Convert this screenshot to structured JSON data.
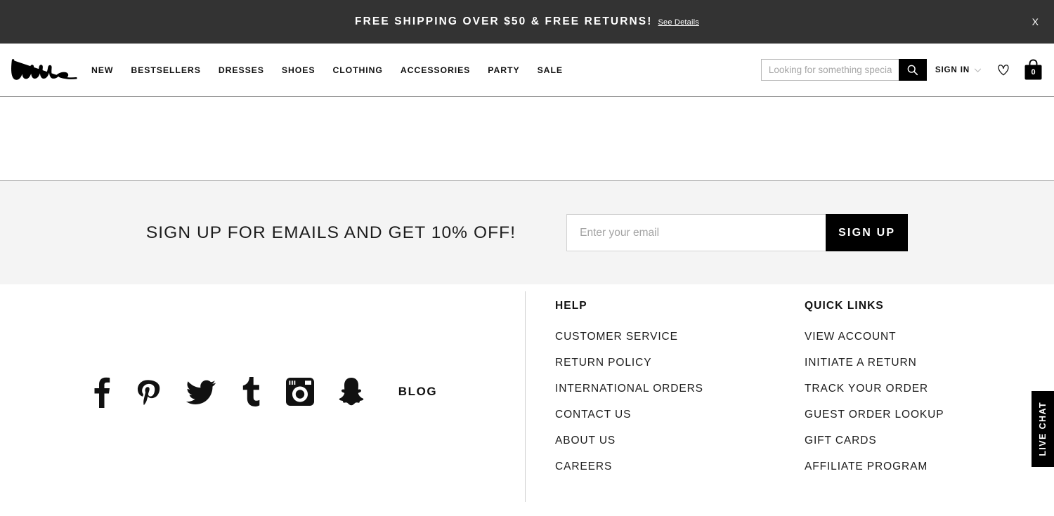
{
  "promo_banner": {
    "message": "FREE SHIPPING OVER $50 & FREE RETURNS!",
    "details_link": "See Details",
    "close_label": "X",
    "background_color": "#333333"
  },
  "header": {
    "logo_text": "Lulus",
    "nav": [
      {
        "label": "NEW"
      },
      {
        "label": "BESTSELLERS"
      },
      {
        "label": "DRESSES"
      },
      {
        "label": "SHOES"
      },
      {
        "label": "CLOTHING"
      },
      {
        "label": "ACCESSORIES"
      },
      {
        "label": "PARTY"
      },
      {
        "label": "SALE"
      }
    ],
    "search": {
      "placeholder": "Looking for something special?",
      "value": "",
      "icon": "search-icon"
    },
    "sign_in_label": "SIGN IN",
    "wishlist_icon": "heart-icon",
    "bag": {
      "icon": "shopping-bag-icon",
      "count": "0"
    }
  },
  "newsletter": {
    "headline": "SIGN UP FOR EMAILS AND GET 10% OFF!",
    "email_placeholder": "Enter your email",
    "email_value": "",
    "button_label": "SIGN UP",
    "background_color": "#f4f4f4"
  },
  "footer": {
    "social": [
      {
        "name": "facebook-icon"
      },
      {
        "name": "pinterest-icon"
      },
      {
        "name": "twitter-icon"
      },
      {
        "name": "tumblr-icon"
      },
      {
        "name": "instagram-icon"
      },
      {
        "name": "snapchat-icon"
      }
    ],
    "blog_label": "BLOG",
    "columns": [
      {
        "title": "HELP",
        "links": [
          "CUSTOMER SERVICE",
          "RETURN POLICY",
          "INTERNATIONAL ORDERS",
          "CONTACT US",
          "ABOUT US",
          "CAREERS"
        ]
      },
      {
        "title": "QUICK LINKS",
        "links": [
          "VIEW ACCOUNT",
          "INITIATE A RETURN",
          "TRACK YOUR ORDER",
          "GUEST ORDER LOOKUP",
          "GIFT CARDS",
          "AFFILIATE PROGRAM"
        ]
      }
    ]
  },
  "live_chat": {
    "label": "LIVE CHAT"
  }
}
